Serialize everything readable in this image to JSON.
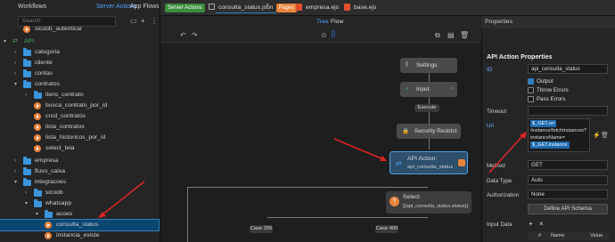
{
  "left": {
    "tabs": {
      "workflows": "Workflows",
      "server_actions": "Server Actions",
      "app_flows": "App Flows"
    },
    "search_placeholder": "Search",
    "tree": [
      {
        "label": "sicoob_autenticar",
        "kind": "action"
      },
      {
        "label": "API",
        "kind": "api"
      },
      {
        "label": "categoria",
        "kind": "folder"
      },
      {
        "label": "cliente",
        "kind": "folder"
      },
      {
        "label": "contas",
        "kind": "folder"
      },
      {
        "label": "contratos",
        "kind": "folder"
      },
      {
        "label": "itens_contrato",
        "kind": "folder"
      },
      {
        "label": "busca_contrato_por_id",
        "kind": "action"
      },
      {
        "label": "crud_contratos",
        "kind": "action"
      },
      {
        "label": "lista_contratos",
        "kind": "action"
      },
      {
        "label": "lista_historicos_por_id",
        "kind": "action"
      },
      {
        "label": "select_tela",
        "kind": "action"
      },
      {
        "label": "empresa",
        "kind": "folder"
      },
      {
        "label": "fluxo_caixa",
        "kind": "folder"
      },
      {
        "label": "integracoes",
        "kind": "folder"
      },
      {
        "label": "sicoob",
        "kind": "folder"
      },
      {
        "label": "whatsapp",
        "kind": "folder"
      },
      {
        "label": "acoes",
        "kind": "folder"
      },
      {
        "label": "consulta_status",
        "kind": "action"
      },
      {
        "label": "instancia_existe",
        "kind": "action"
      }
    ]
  },
  "tabs": {
    "server_actions": "Server Actions",
    "consulta_status": "consulta_status.json",
    "pages": "Pages",
    "empresa": "empresa.ejs",
    "base": "base.ejs"
  },
  "middle": {
    "views": {
      "tree": "Tree",
      "flow": "Flow"
    },
    "nodes": {
      "settings": "Settings",
      "input": "Input",
      "execute": "Execute",
      "security": "Security Restrict",
      "api_title": "API Action:",
      "api_sub": "api_consulta_status",
      "select_title": "Select",
      "select_sub": "{{api_consulta_status.status}}",
      "case200": "Case 200",
      "case400": "Case 400"
    }
  },
  "properties": {
    "header": "Properties",
    "title": "API Action Properties",
    "id_label": "ID",
    "id_value": "api_consulta_status",
    "output": "Output",
    "throw_errors": "Throw Errors",
    "pass_errors": "Pass Errors",
    "timeout_label": "Timeout",
    "url_label": "Url",
    "url_chip1": "$_GET.url",
    "url_text1": "/instance/fetchInstances?",
    "url_text2": "instanceName=",
    "url_chip2": "$_GET.instance",
    "method_label": "Method",
    "method_value": "GET",
    "data_type_label": "Data Type",
    "data_type_value": "Auto",
    "authorization_label": "Authorization",
    "authorization_value": "None",
    "define_schema": "Define API Schema",
    "input_data": "Input Data",
    "col_hash": "#",
    "col_name": "Name",
    "col_value": "Value"
  },
  "colors": {
    "accent": "#2f7fbf",
    "action_icon": "#e8833a",
    "folder": "#3a96dd",
    "arrow": "#e02424"
  }
}
